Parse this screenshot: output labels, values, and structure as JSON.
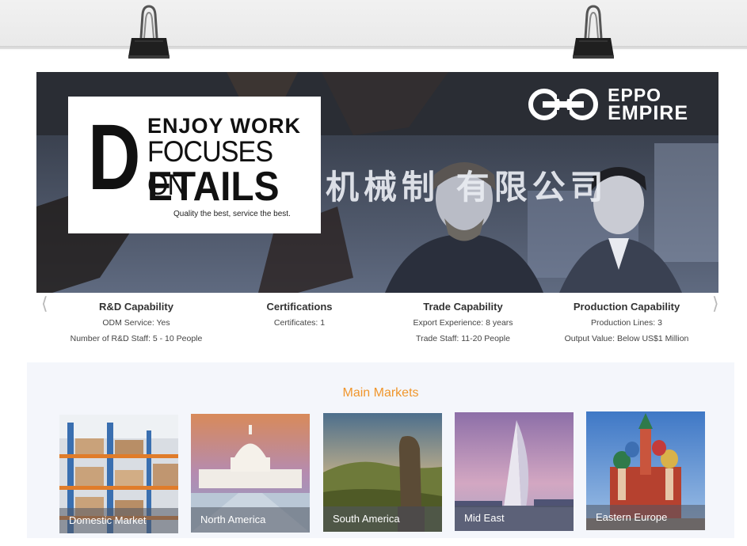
{
  "banner": {
    "slogan_d": "D",
    "slogan_line1": "ENJOY WORK",
    "slogan_line2": "FOCUSES ON",
    "slogan_line3": "ETAILS",
    "tagline": "Quality the best, service the best.",
    "logo_line1": "EPPO",
    "logo_line2": "EMPIRE",
    "background_text": "机械制  有限公司"
  },
  "carousel": {
    "prev_icon": "chevron-left-icon",
    "next_icon": "chevron-right-icon",
    "items": [
      {
        "title": "R&D Capability",
        "lines": [
          "ODM Service:  Yes",
          "Number of R&D Staff:  5 - 10 People"
        ]
      },
      {
        "title": "Certifications",
        "lines": [
          "Certificates:  1"
        ]
      },
      {
        "title": "Trade Capability",
        "lines": [
          "Export Experience:  8 years",
          "Trade Staff:  11-20 People"
        ]
      },
      {
        "title": "Production Capability",
        "lines": [
          "Production Lines:  3",
          "Output Value:  Below US$1 Million"
        ]
      }
    ]
  },
  "markets": {
    "title": "Main Markets",
    "items": [
      {
        "label": "Domestic Market"
      },
      {
        "label": "North America"
      },
      {
        "label": "South America"
      },
      {
        "label": "Mid East"
      },
      {
        "label": "Eastern Europe"
      }
    ]
  },
  "colors": {
    "accent": "#f0962c",
    "banner_dark": "#2a2d34",
    "markets_bg": "#f4f6fb"
  }
}
